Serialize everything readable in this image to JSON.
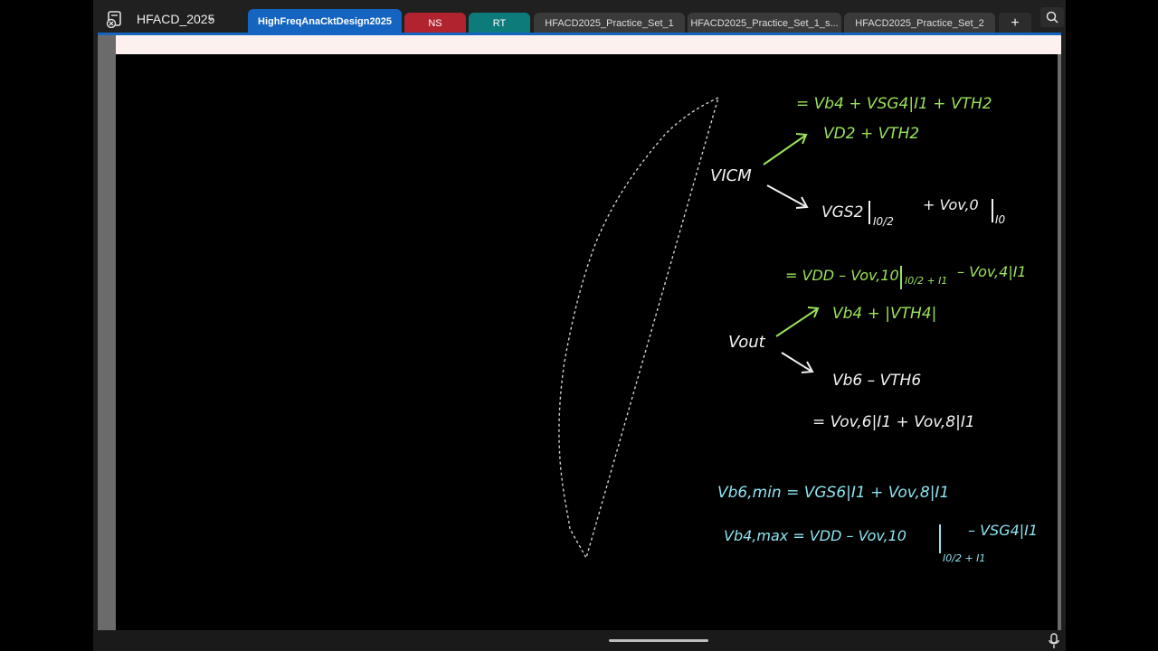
{
  "notebook": {
    "title": "HFACD_2025",
    "chevron": "⌄"
  },
  "tabs": [
    {
      "label": "HighFreqAnaCktDesign2025",
      "style": "active"
    },
    {
      "label": "NS",
      "style": "red"
    },
    {
      "label": "RT",
      "style": "teal"
    },
    {
      "label": "HFACD2025_Practice_Set_1",
      "style": "grey"
    },
    {
      "label": "HFACD2025_Practice_Set_1_s...",
      "style": "grey"
    },
    {
      "label": "HFACD2025_Practice_Set_2",
      "style": "grey"
    }
  ],
  "add_tab_label": "+",
  "icons": {
    "notebook": "notebook-icon",
    "search": "search-icon",
    "mic": "microphone-icon"
  },
  "colors": {
    "green_ink": "#9be35a",
    "white_ink": "#f2f2f2",
    "cyan_ink": "#8fe3f0",
    "accent_tab": "#1565c0"
  },
  "notes": {
    "vicm_label": "VICM",
    "vicm_eq1": "= Vb4 + VSG4|I1 + VTH2",
    "vicm_upper": "VD2 + VTH2",
    "vicm_lower_a": "VGS2",
    "vicm_lower_a_sub": "I0/2",
    "vicm_lower_b": "+ Vov,0",
    "vicm_lower_b_sub": "I0",
    "vout_eq1_a": "= VDD – Vov,10",
    "vout_eq1_sub": "I0/2 + I1",
    "vout_eq1_b": "– Vov,4|I1",
    "vout_label": "Vout",
    "vout_upper": "Vb4 + |VTH4|",
    "vout_lower": "Vb6 – VTH6",
    "vout_lower_eq": "= Vov,6|I1 + Vov,8|I1",
    "vb6_min": "Vb6,min = VGS6|I1 + Vov,8|I1",
    "vb4_max_a": "Vb4,max = VDD – Vov,10",
    "vb4_max_sub": "I0/2 + I1",
    "vb4_max_b": "– VSG4|I1"
  }
}
